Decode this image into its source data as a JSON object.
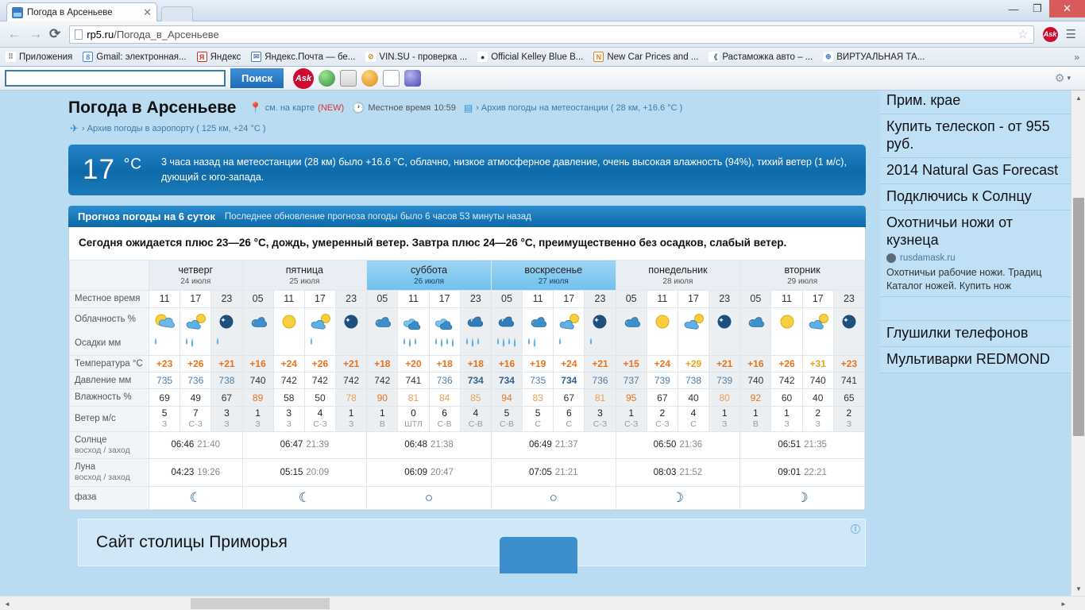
{
  "browser": {
    "tab_title": "Погода в Арсеньеве",
    "tab_close": "✕",
    "url_host": "rp5.ru",
    "url_path": "/Погода_в_Арсеньеве",
    "back_icon": "←",
    "forward_icon": "→",
    "reload_icon": "⟳",
    "star_icon": "☆",
    "ask_icon": "Ask",
    "menu_icon": "☰",
    "minimize": "—",
    "maximize": "❐",
    "close": "✕",
    "bookmarks": [
      {
        "label": "Приложения",
        "glyph": "⠿",
        "color": "#999999"
      },
      {
        "label": "Gmail: электронная...",
        "glyph": "8",
        "color": "#4285f4"
      },
      {
        "label": "Яндекс",
        "glyph": "Я",
        "color": "#ffffff"
      },
      {
        "label": "Яндекс.Почта — бе...",
        "glyph": "✉",
        "color": "#4a7fb5"
      },
      {
        "label": "VIN.SU - проверка ...",
        "glyph": "⊘",
        "color": "#e0a030"
      },
      {
        "label": "Official Kelley Blue B...",
        "glyph": "●",
        "color": "#1f3d5c"
      },
      {
        "label": "New Car Prices and ...",
        "glyph": "N",
        "color": "#e08020"
      },
      {
        "label": "Растаможка авто – ...",
        "glyph": "《",
        "color": "#2b5f8f"
      },
      {
        "label": "ВИРТУАЛЬНАЯ ТА...",
        "glyph": "⊕",
        "color": "#3b7cc4"
      }
    ],
    "bookmarks_overflow": "»"
  },
  "toolbar2": {
    "search_value": "",
    "search_placeholder": "",
    "search_button": "Поиск",
    "ask_label": "Ask",
    "icons": [
      "globe-icon",
      "pen-icon",
      "smiley-icon",
      "news-icon",
      "help-icon"
    ],
    "settings_icon": "⚙",
    "settings_caret": "▾"
  },
  "header": {
    "city_title": "Погода в Арсеньеве",
    "map_link": "см. на карте",
    "map_new": "(NEW)",
    "local_time_label": "Местное время",
    "local_time_value": "10:59",
    "station_archive": "› Архив погоды на метеостанции ( 28 км, +16.6 °C )",
    "airport_archive": "› Архив погоды в аэропорту ( 125 км, +24 °C )"
  },
  "now": {
    "temp": "17",
    "unit": "°C",
    "description": "3 часа назад на метеостанции (28 км) было +16.6 °C, облачно, низкое атмосферное давление, очень высокая влажность (94%), тихий ветер (1 м/с), дующий с юго-запада."
  },
  "forecast": {
    "title": "Прогноз погоды на 6 суток",
    "updated": "Последнее обновление прогноза погоды было 6 часов 53 минуты назад",
    "summary": "Сегодня ожидается плюс 23—26 °C, дождь, умеренный ветер. Завтра плюс 24—26 °C, преимущественно без осадков, слабый ветер.",
    "row_labels": {
      "time": "Местное время",
      "clouds": "Облачность %",
      "precip": "Осадки мм",
      "temp": "Температура °C",
      "pressure": "Давление мм",
      "humidity": "Влажность %",
      "wind": "Ветер м/с",
      "sun_main": "Солнце",
      "sun_sub": "восход / заход",
      "moon_main": "Луна",
      "moon_sub": "восход / заход",
      "phase": "фаза"
    },
    "days": [
      {
        "name": "четверг",
        "date": "24 июля",
        "weekend": false,
        "hours": [
          "11",
          "17",
          "23"
        ]
      },
      {
        "name": "пятница",
        "date": "25 июля",
        "weekend": false,
        "hours": [
          "05",
          "11",
          "17",
          "23"
        ]
      },
      {
        "name": "суббота",
        "date": "26 июля",
        "weekend": true,
        "hours": [
          "05",
          "11",
          "17",
          "23"
        ]
      },
      {
        "name": "воскресенье",
        "date": "27 июля",
        "weekend": true,
        "hours": [
          "05",
          "11",
          "17",
          "23"
        ]
      },
      {
        "name": "понедельник",
        "date": "28 июля",
        "weekend": false,
        "hours": [
          "05",
          "11",
          "17",
          "23"
        ]
      },
      {
        "name": "вторник",
        "date": "29 июля",
        "weekend": false,
        "hours": [
          "05",
          "11",
          "17",
          "23"
        ]
      }
    ],
    "columns": [
      {
        "day": 0,
        "hour": "11",
        "night": false,
        "icon": "sun-cloud",
        "precip": "drop1",
        "temp": "+23",
        "temp_color": "#e8731c",
        "pressure": "735",
        "pressure_color": "#4a7fae",
        "humidity": "69",
        "humidity_color": "#333333",
        "wind_speed": "5",
        "wind_dir": "З"
      },
      {
        "day": 0,
        "hour": "17",
        "night": false,
        "icon": "cloud-sun",
        "precip": "drop2",
        "temp": "+26",
        "temp_color": "#e8731c",
        "pressure": "736",
        "pressure_color": "#4a7fae",
        "humidity": "49",
        "humidity_color": "#333333",
        "wind_speed": "7",
        "wind_dir": "С-З"
      },
      {
        "day": 0,
        "hour": "23",
        "night": true,
        "icon": "moon",
        "precip": "drop1",
        "temp": "+21",
        "temp_color": "#e8731c",
        "pressure": "738",
        "pressure_color": "#4a7fae",
        "humidity": "67",
        "humidity_color": "#333333",
        "wind_speed": "3",
        "wind_dir": "З"
      },
      {
        "day": 1,
        "hour": "05",
        "night": true,
        "icon": "rain-cloud",
        "precip": "",
        "temp": "+16",
        "temp_color": "#e8731c",
        "pressure": "740",
        "pressure_color": "#333333",
        "humidity": "89",
        "humidity_color": "#e8731c",
        "wind_speed": "1",
        "wind_dir": "З"
      },
      {
        "day": 1,
        "hour": "11",
        "night": false,
        "icon": "sun",
        "precip": "",
        "temp": "+24",
        "temp_color": "#e8731c",
        "pressure": "742",
        "pressure_color": "#333333",
        "humidity": "58",
        "humidity_color": "#333333",
        "wind_speed": "3",
        "wind_dir": "З"
      },
      {
        "day": 1,
        "hour": "17",
        "night": false,
        "icon": "cloud-sun",
        "precip": "drop1",
        "temp": "+26",
        "temp_color": "#e8731c",
        "pressure": "742",
        "pressure_color": "#333333",
        "humidity": "50",
        "humidity_color": "#333333",
        "wind_speed": "4",
        "wind_dir": "С-З"
      },
      {
        "day": 1,
        "hour": "23",
        "night": true,
        "icon": "moon",
        "precip": "",
        "temp": "+21",
        "temp_color": "#e8731c",
        "pressure": "742",
        "pressure_color": "#333333",
        "humidity": "78",
        "humidity_color": "#e8a050",
        "wind_speed": "1",
        "wind_dir": "З"
      },
      {
        "day": 2,
        "hour": "05",
        "night": true,
        "icon": "rain-cloud",
        "precip": "",
        "temp": "+18",
        "temp_color": "#e8731c",
        "pressure": "742",
        "pressure_color": "#333333",
        "humidity": "90",
        "humidity_color": "#e8731c",
        "wind_speed": "1",
        "wind_dir": "В"
      },
      {
        "day": 2,
        "hour": "11",
        "night": false,
        "icon": "rain-heavy",
        "precip": "drops3",
        "temp": "+20",
        "temp_color": "#e8731c",
        "pressure": "741",
        "pressure_color": "#333333",
        "humidity": "81",
        "humidity_color": "#e8a050",
        "wind_speed": "0",
        "wind_dir": "ШТЛ"
      },
      {
        "day": 2,
        "hour": "17",
        "night": false,
        "icon": "rain-heavy",
        "precip": "drops4",
        "temp": "+18",
        "temp_color": "#e8731c",
        "pressure": "736",
        "pressure_color": "#4a7fae",
        "humidity": "84",
        "humidity_color": "#e8a050",
        "wind_speed": "6",
        "wind_dir": "С-В"
      },
      {
        "day": 2,
        "hour": "23",
        "night": true,
        "icon": "rain-storm",
        "precip": "drops3",
        "temp": "+18",
        "temp_color": "#e8731c",
        "pressure": "734",
        "pressure_color": "#2e6390",
        "humidity": "85",
        "humidity_color": "#e8a050",
        "wind_speed": "4",
        "wind_dir": "С-В"
      },
      {
        "day": 3,
        "hour": "05",
        "night": true,
        "icon": "rain-storm",
        "precip": "drops4",
        "temp": "+16",
        "temp_color": "#e8731c",
        "pressure": "734",
        "pressure_color": "#2e6390",
        "humidity": "94",
        "humidity_color": "#e8731c",
        "wind_speed": "5",
        "wind_dir": "С-В"
      },
      {
        "day": 3,
        "hour": "11",
        "night": false,
        "icon": "rain-cloud",
        "precip": "drops2",
        "temp": "+19",
        "temp_color": "#e8731c",
        "pressure": "735",
        "pressure_color": "#4a7fae",
        "humidity": "83",
        "humidity_color": "#e8a050",
        "wind_speed": "5",
        "wind_dir": "С"
      },
      {
        "day": 3,
        "hour": "17",
        "night": false,
        "icon": "cloud-sun",
        "precip": "drop1",
        "temp": "+24",
        "temp_color": "#e8731c",
        "pressure": "734",
        "pressure_color": "#2e6390",
        "humidity": "67",
        "humidity_color": "#333333",
        "wind_speed": "6",
        "wind_dir": "С"
      },
      {
        "day": 3,
        "hour": "23",
        "night": true,
        "icon": "moon",
        "precip": "drop1",
        "temp": "+21",
        "temp_color": "#e8731c",
        "pressure": "736",
        "pressure_color": "#4a7fae",
        "humidity": "81",
        "humidity_color": "#e8a050",
        "wind_speed": "3",
        "wind_dir": "С-З"
      },
      {
        "day": 4,
        "hour": "05",
        "night": true,
        "icon": "rain-cloud",
        "precip": "",
        "temp": "+15",
        "temp_color": "#e8731c",
        "pressure": "737",
        "pressure_color": "#4a7fae",
        "humidity": "95",
        "humidity_color": "#e8731c",
        "wind_speed": "1",
        "wind_dir": "С-З"
      },
      {
        "day": 4,
        "hour": "11",
        "night": false,
        "icon": "sun",
        "precip": "",
        "temp": "+24",
        "temp_color": "#e8731c",
        "pressure": "739",
        "pressure_color": "#4a7fae",
        "humidity": "67",
        "humidity_color": "#333333",
        "wind_speed": "2",
        "wind_dir": "С-З"
      },
      {
        "day": 4,
        "hour": "17",
        "night": false,
        "icon": "cloud-sun",
        "precip": "",
        "temp": "+29",
        "temp_color": "#e8a020",
        "pressure": "738",
        "pressure_color": "#4a7fae",
        "humidity": "40",
        "humidity_color": "#333333",
        "wind_speed": "4",
        "wind_dir": "С"
      },
      {
        "day": 4,
        "hour": "23",
        "night": true,
        "icon": "moon",
        "precip": "",
        "temp": "+21",
        "temp_color": "#e8731c",
        "pressure": "739",
        "pressure_color": "#4a7fae",
        "humidity": "80",
        "humidity_color": "#e8a050",
        "wind_speed": "1",
        "wind_dir": "З"
      },
      {
        "day": 5,
        "hour": "05",
        "night": true,
        "icon": "rain-cloud",
        "precip": "",
        "temp": "+16",
        "temp_color": "#e8731c",
        "pressure": "740",
        "pressure_color": "#333333",
        "humidity": "92",
        "humidity_color": "#e8731c",
        "wind_speed": "1",
        "wind_dir": "В"
      },
      {
        "day": 5,
        "hour": "11",
        "night": false,
        "icon": "sun",
        "precip": "",
        "temp": "+26",
        "temp_color": "#e8731c",
        "pressure": "742",
        "pressure_color": "#333333",
        "humidity": "60",
        "humidity_color": "#333333",
        "wind_speed": "1",
        "wind_dir": "З"
      },
      {
        "day": 5,
        "hour": "17",
        "night": false,
        "icon": "cloud-sun",
        "precip": "",
        "temp": "+31",
        "temp_color": "#e8a020",
        "pressure": "740",
        "pressure_color": "#333333",
        "humidity": "40",
        "humidity_color": "#333333",
        "wind_speed": "2",
        "wind_dir": "З"
      },
      {
        "day": 5,
        "hour": "23",
        "night": true,
        "icon": "moon",
        "precip": "",
        "temp": "+23",
        "temp_color": "#e8731c",
        "pressure": "741",
        "pressure_color": "#333333",
        "humidity": "65",
        "humidity_color": "#333333",
        "wind_speed": "2",
        "wind_dir": "З"
      }
    ],
    "astro": [
      {
        "sun_rise": "06:46",
        "sun_set": "21:40",
        "moon_rise": "04:23",
        "moon_set": "19:26",
        "phase": "☾"
      },
      {
        "sun_rise": "06:47",
        "sun_set": "21:39",
        "moon_rise": "05:15",
        "moon_set": "20:09",
        "phase": "☾"
      },
      {
        "sun_rise": "06:48",
        "sun_set": "21:38",
        "moon_rise": "06:09",
        "moon_set": "20:47",
        "phase": "○"
      },
      {
        "sun_rise": "06:49",
        "sun_set": "21:37",
        "moon_rise": "07:05",
        "moon_set": "21:21",
        "phase": "○"
      },
      {
        "sun_rise": "06:50",
        "sun_set": "21:36",
        "moon_rise": "08:03",
        "moon_set": "21:52",
        "phase": "☽"
      },
      {
        "sun_rise": "06:51",
        "sun_set": "21:35",
        "moon_rise": "09:01",
        "moon_set": "22:21",
        "phase": "☽"
      }
    ]
  },
  "bottom_banner": {
    "title": "Сайт столицы Приморья",
    "info_icon": "i"
  },
  "sidebar": {
    "ads": [
      {
        "title": "Прим. крае"
      },
      {
        "title": "Купить телескоп - от 955 руб."
      },
      {
        "title": "2014 Natural Gas Forecast"
      },
      {
        "title": "Подключись к Солнцу"
      },
      {
        "title": "Охотничьи ножи от кузнеца",
        "site": "rusdamask.ru",
        "desc_line1": "Охотничьи рабочие ножи. Традиц",
        "desc_line2": "Каталог ножей. Купить нож"
      },
      {
        "title": "Глушилки телефонов"
      },
      {
        "title": "Мультиварки REDMOND"
      }
    ]
  },
  "scroll": {
    "v_up": "▲",
    "v_down": "▼",
    "h_left": "◄",
    "h_right": "►"
  }
}
